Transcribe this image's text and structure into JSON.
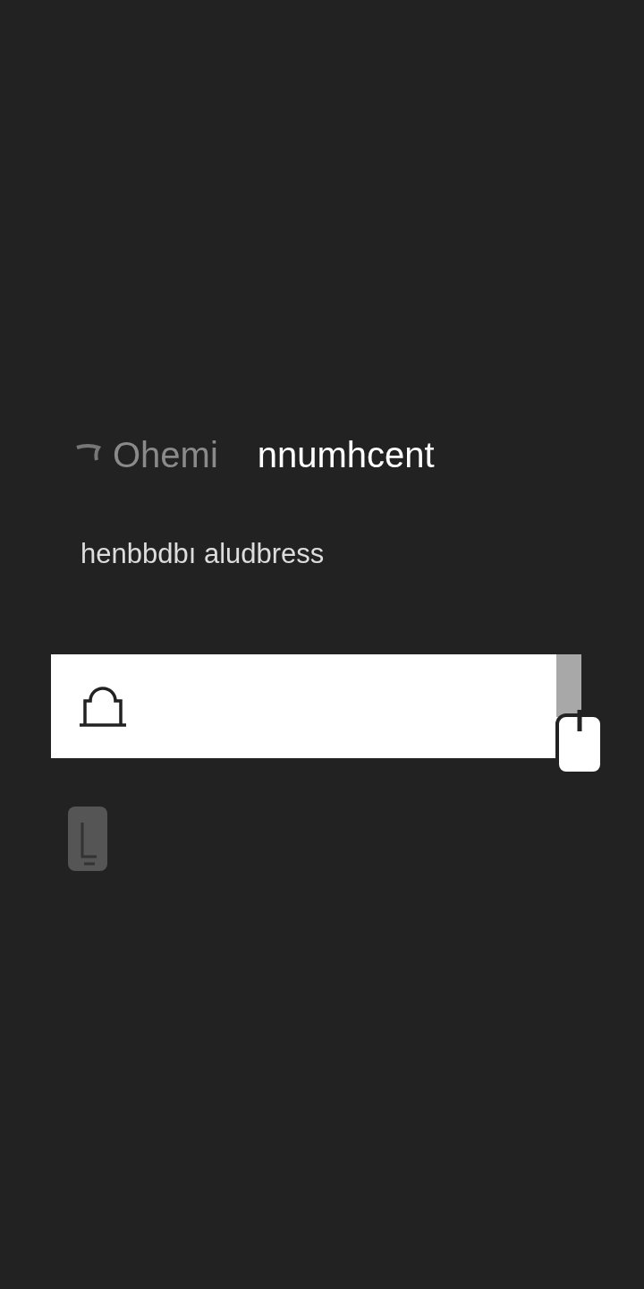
{
  "header": {
    "label": "Ohemi",
    "value": "nnumhcent"
  },
  "subtitle": "henbbdbı aludbress",
  "field": {
    "kind": "password"
  }
}
